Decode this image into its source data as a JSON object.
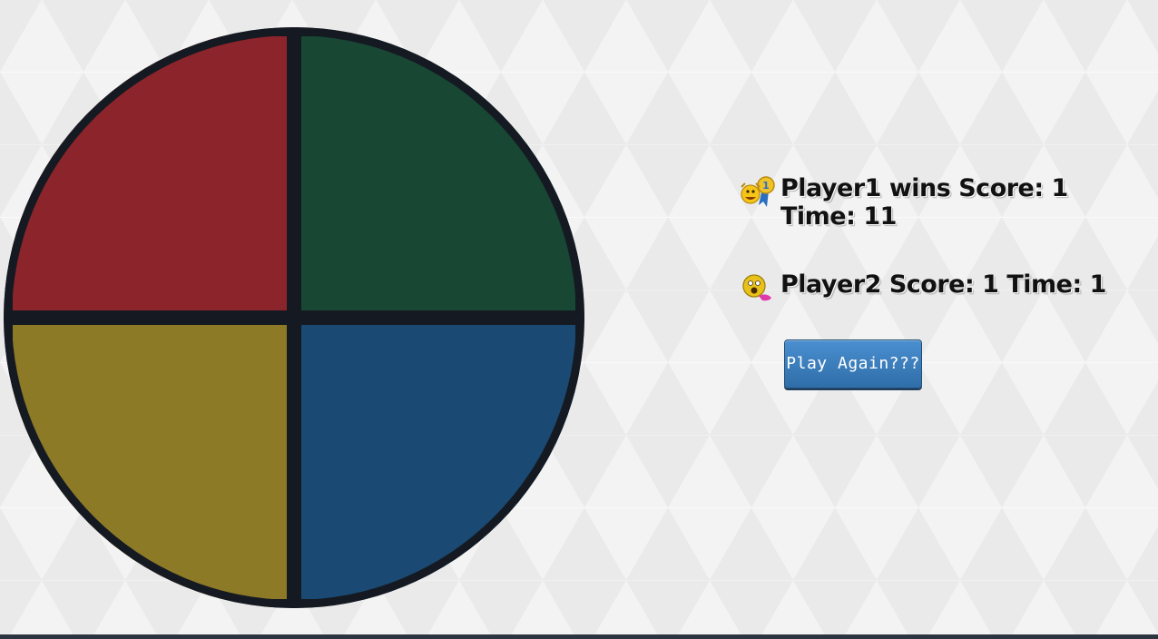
{
  "board": {
    "colors": {
      "red": "#8c252b",
      "green": "#184734",
      "yellow": "#8c7a27",
      "blue": "#1a4a73",
      "border": "#151a22"
    }
  },
  "results": {
    "player1": {
      "icon": "winner-medal-icon",
      "line1": "Player1 wins Score: 1",
      "line2": "Time: 11"
    },
    "player2": {
      "icon": "loser-face-icon",
      "line1": "Player2 Score: 1 Time: 1"
    },
    "play_again_label": "Play Again???"
  }
}
